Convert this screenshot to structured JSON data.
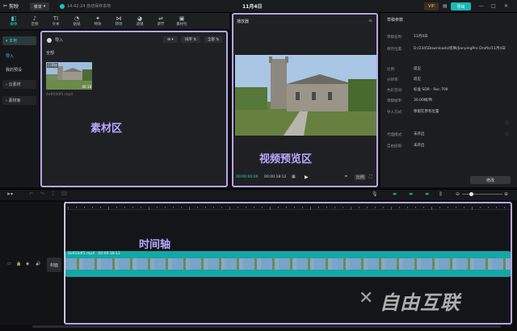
{
  "app": {
    "name": "剪映",
    "menu_label": "菜单",
    "autosave_text": "14:42:24 自动保存本地",
    "project_title": "11月4日",
    "vip_label": "VIP",
    "export_label": "导出"
  },
  "toolbar": {
    "tabs": [
      {
        "label": "媒体",
        "icon": "◧"
      },
      {
        "label": "音频",
        "icon": "♪"
      },
      {
        "label": "文本",
        "icon": "TI"
      },
      {
        "label": "贴纸",
        "icon": "◔"
      },
      {
        "label": "特效",
        "icon": "✦"
      },
      {
        "label": "转场",
        "icon": "⋈"
      },
      {
        "label": "滤镜",
        "icon": "◕"
      },
      {
        "label": "调节",
        "icon": "⇌"
      },
      {
        "label": "素材包",
        "icon": "▣"
      }
    ]
  },
  "leftnav": {
    "items": [
      "▾ 本地",
      "导入",
      "我的预设",
      "› 云素材",
      "› 素材库"
    ]
  },
  "media": {
    "import_label": "导入",
    "view_label": "⊞ ▾",
    "sort_label": "排序 ⇅",
    "all_btn": "全部 ⇅",
    "all_label": "全部",
    "thumb_badge": "已添加",
    "thumb_duration": "00:18",
    "file_name": "4e910df1.mp4",
    "overlay_label": "素材区"
  },
  "player": {
    "title": "播放器",
    "time_current": "00:00:00:00",
    "time_total": "00:00:18:12",
    "ratio_btn": "比例",
    "overlay_label": "视频预览区"
  },
  "props": {
    "title": "草稿参数",
    "rows": [
      {
        "k": "草稿名称:",
        "v": "11月4日"
      },
      {
        "k": "保存位置:",
        "v": "D:/2345Downloads/剪映/JianyingPro Drafts/11月4日"
      },
      {
        "k": "比例:",
        "v": "适应"
      },
      {
        "k": "分辨率:",
        "v": "适应"
      },
      {
        "k": "色彩空间:",
        "v": "标准 SDR - Rec.709"
      },
      {
        "k": "草稿帧率:",
        "v": "30.00帧/秒"
      },
      {
        "k": "导入方式:",
        "v": "保留在原有位置"
      },
      {
        "k": "代理模式:",
        "v": "未开启"
      },
      {
        "k": "自由层级:",
        "v": "未开启"
      }
    ],
    "edit_label": "修改"
  },
  "timeline": {
    "overlay_label": "时间轴",
    "clip_name": "4e910df1.mp4",
    "clip_duration": "00:00:18:12",
    "cover_label": "封面",
    "ruler": [
      "00:00",
      "00:05",
      "00:10",
      "00:15",
      "00:20",
      "00:25",
      "00:30",
      "00:35",
      "00:40",
      "00:45"
    ]
  },
  "watermark": "自由互联"
}
